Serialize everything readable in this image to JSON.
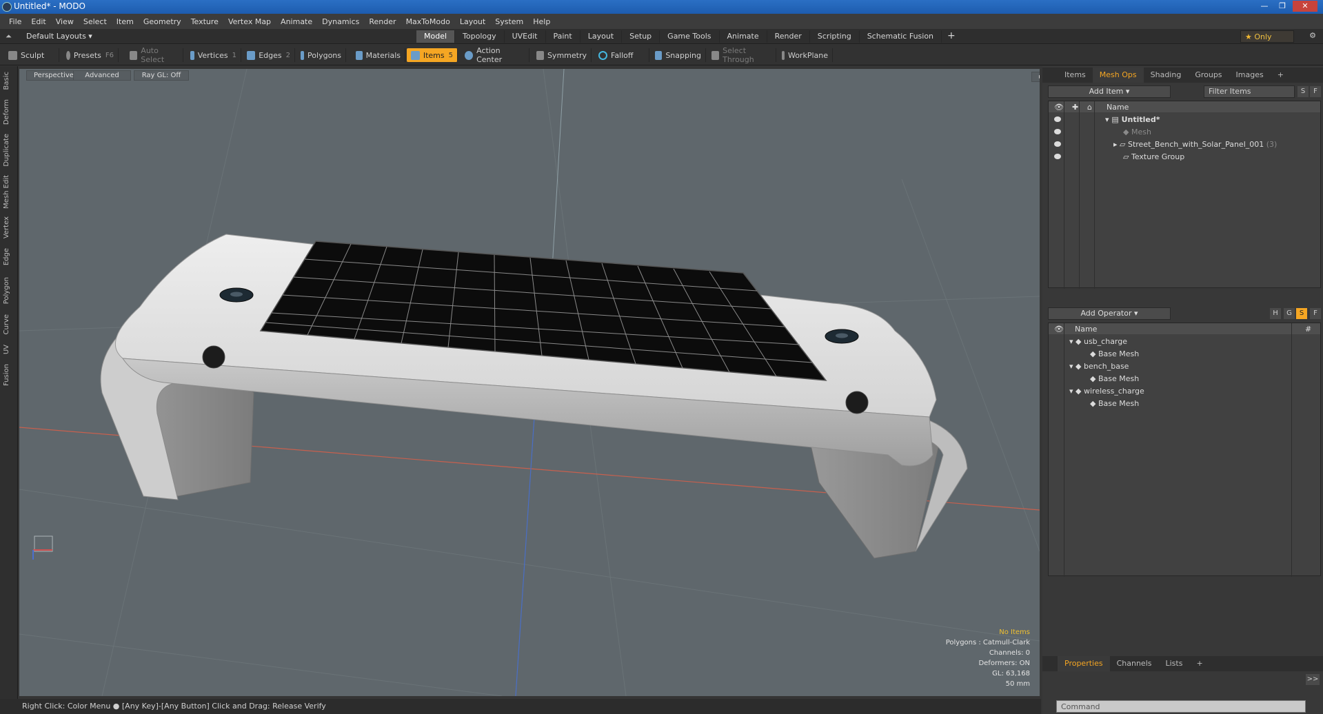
{
  "window": {
    "title": "Untitled* - MODO"
  },
  "menu": [
    "File",
    "Edit",
    "View",
    "Select",
    "Item",
    "Geometry",
    "Texture",
    "Vertex Map",
    "Animate",
    "Dynamics",
    "Render",
    "MaxToModo",
    "Layout",
    "System",
    "Help"
  ],
  "layout_bar": {
    "layout_selector": "Default Layouts ▾",
    "tabs": [
      "Model",
      "Topology",
      "UVEdit",
      "Paint",
      "Layout",
      "Setup",
      "Game Tools",
      "Animate",
      "Render",
      "Scripting",
      "Schematic Fusion"
    ],
    "active_tab": "Model",
    "only_label": "Only"
  },
  "toolbar": {
    "sculpt": "Sculpt",
    "presets": "Presets",
    "presets_key": "F6",
    "auto_select": "Auto Select",
    "vertices": "Vertices",
    "vertices_key": "1",
    "edges": "Edges",
    "edges_key": "2",
    "polygons": "Polygons",
    "materials": "Materials",
    "items": "Items",
    "items_key": "5",
    "action_center": "Action Center",
    "symmetry": "Symmetry",
    "falloff": "Falloff",
    "snapping": "Snapping",
    "select_through": "Select Through",
    "workplane": "WorkPlane"
  },
  "left_strip": [
    "Basic",
    "Deform",
    "Duplicate",
    "Mesh Edit",
    "Vertex",
    "Edge",
    "Polygon",
    "Curve",
    "UV",
    "Fusion"
  ],
  "viewport": {
    "view": "Perspective",
    "shading": "Advanced",
    "raygl": "Ray GL: Off",
    "info": {
      "selection": "No Items",
      "polygons": "Polygons : Catmull-Clark",
      "channels": "Channels: 0",
      "deformers": "Deformers: ON",
      "gl": "GL: 63,168",
      "scale": "50 mm"
    }
  },
  "status": {
    "hint": "Right Click: Color Menu ● [Any Key]-[Any Button] Click and Drag: Release Verify"
  },
  "items_panel": {
    "tabs": [
      "Items",
      "Mesh Ops",
      "Shading",
      "Groups",
      "Images"
    ],
    "active_tab": "Mesh Ops",
    "add_item": "Add Item",
    "filter": "Filter Items",
    "col_name": "Name",
    "tree": [
      {
        "label": "Untitled*",
        "level": 0
      },
      {
        "label": "Mesh",
        "level": 1
      },
      {
        "label": "Street_Bench_with_Solar_Panel_001",
        "count": "(3)",
        "level": 1
      },
      {
        "label": "Texture Group",
        "level": 1
      }
    ]
  },
  "meshops_panel": {
    "add_operator": "Add Operator",
    "col_name": "Name",
    "col_hash": "#",
    "btns": [
      "H",
      "G",
      "S",
      "F"
    ],
    "tree": [
      {
        "label": "usb_charge",
        "level": 0
      },
      {
        "label": "Base Mesh",
        "level": 1
      },
      {
        "label": "bench_base",
        "level": 0
      },
      {
        "label": "Base Mesh",
        "level": 1
      },
      {
        "label": "wireless_charge",
        "level": 0
      },
      {
        "label": "Base Mesh",
        "level": 1
      }
    ]
  },
  "properties_panel": {
    "tabs": [
      "Properties",
      "Channels",
      "Lists"
    ],
    "active_tab": "Properties",
    "command_placeholder": "Command",
    "expand": ">>"
  }
}
